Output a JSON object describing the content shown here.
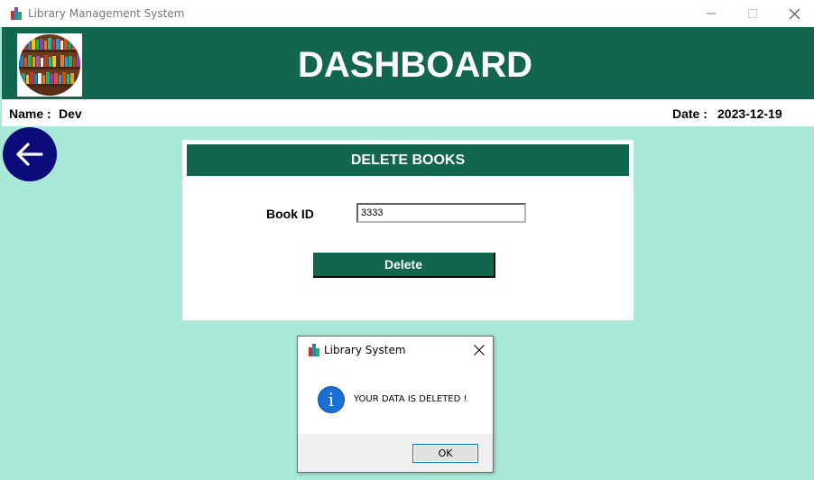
{
  "window": {
    "title": "Library Management System"
  },
  "header": {
    "title": "DASHBOARD"
  },
  "user": {
    "name_label": "Name :",
    "name_value": "Dev",
    "date_label": "Date :",
    "date_value": "2023-12-19"
  },
  "panel": {
    "title": "DELETE BOOKS",
    "book_id_label": "Book ID",
    "book_id_value": "3333",
    "delete_label": "Delete"
  },
  "dialog": {
    "title": "Library System",
    "message": "YOUR DATA IS DELETED !",
    "ok_label": "OK"
  },
  "icons": {
    "back": "arrow-left-icon",
    "info": "info-icon",
    "app": "books-icon"
  },
  "colors": {
    "primary": "#12654e",
    "background": "#a8e9d7",
    "back_button": "#0b0b7a",
    "info": "#1a6fd6"
  }
}
